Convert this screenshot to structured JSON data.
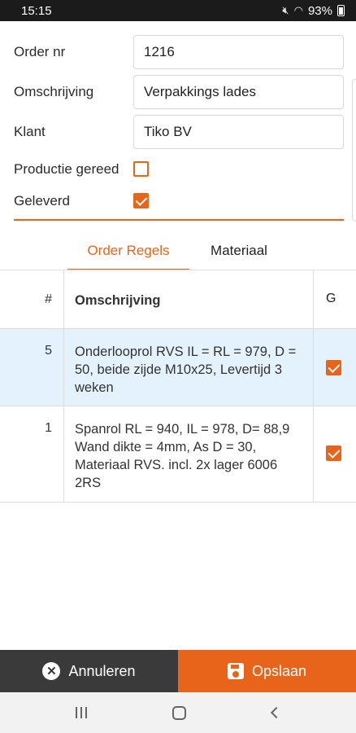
{
  "status_bar": {
    "time": "15:15",
    "battery_percent": "93%",
    "icons": [
      "mute-icon",
      "wifi-icon",
      "signal-icon",
      "battery-icon"
    ]
  },
  "form": {
    "order_nr": {
      "label": "Order nr",
      "value": "1216"
    },
    "omschrijving": {
      "label": "Omschrijving",
      "value": "Verpakkings lades"
    },
    "klant": {
      "label": "Klant",
      "value": "Tiko BV"
    },
    "productie_gereed": {
      "label": "Productie gereed",
      "checked": false
    },
    "geleverd": {
      "label": "Geleverd",
      "checked": true
    }
  },
  "tabs": [
    {
      "label": "Order Regels",
      "active": true
    },
    {
      "label": "Materiaal",
      "active": false
    }
  ],
  "table": {
    "headers": {
      "num": "#",
      "desc": "Omschrijving",
      "g": "G"
    },
    "rows": [
      {
        "num": "5",
        "desc": "Onderlooprol RVS IL = RL = 979, D = 50, beide zijde M10x25, Levertijd 3 weken",
        "g_checked": true,
        "highlighted": true
      },
      {
        "num": "1",
        "desc": "Spanrol RL = 940, IL = 978, D= 88,9 Wand dikte = 4mm, As D = 30, Materiaal RVS. incl. 2x lager 6006 2RS",
        "g_checked": true,
        "highlighted": false
      }
    ]
  },
  "actions": {
    "cancel_label": "Annuleren",
    "save_label": "Opslaan"
  },
  "colors": {
    "accent": "#e8641b",
    "cancel_bg": "#3a3a3a",
    "highlight_row": "#e3f2fc"
  }
}
